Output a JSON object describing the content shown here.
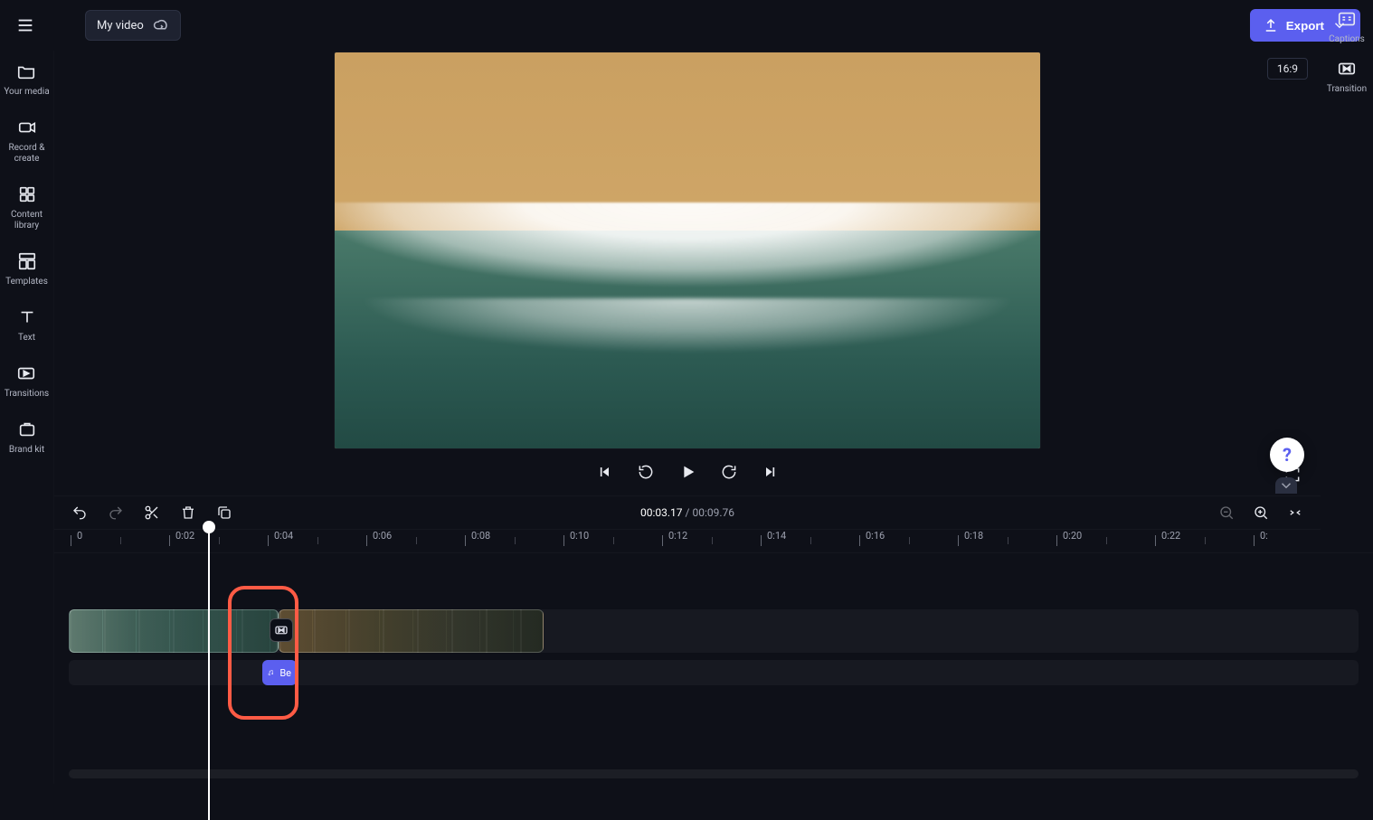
{
  "header": {
    "title": "My video",
    "export_label": "Export",
    "aspect_label": "16:9"
  },
  "left_rail": {
    "items": [
      {
        "label": "Your media"
      },
      {
        "label": "Record & create"
      },
      {
        "label": "Content library"
      },
      {
        "label": "Templates"
      },
      {
        "label": "Text"
      },
      {
        "label": "Transitions"
      },
      {
        "label": "Brand kit"
      }
    ]
  },
  "right_rail": {
    "items": [
      {
        "label": "Captions"
      },
      {
        "label": "Transition"
      }
    ]
  },
  "player": {
    "timecode_current": "00:03.17",
    "timecode_total": "00:09.76",
    "separator": " / "
  },
  "ruler": {
    "ticks": [
      "0",
      "0:02",
      "0:04",
      "0:06",
      "0:08",
      "0:10",
      "0:12",
      "0:14",
      "0:16",
      "0:18",
      "0:20",
      "0:22",
      "0:"
    ]
  },
  "audio": {
    "clip_label": "Be"
  },
  "help": {
    "label": "?"
  }
}
